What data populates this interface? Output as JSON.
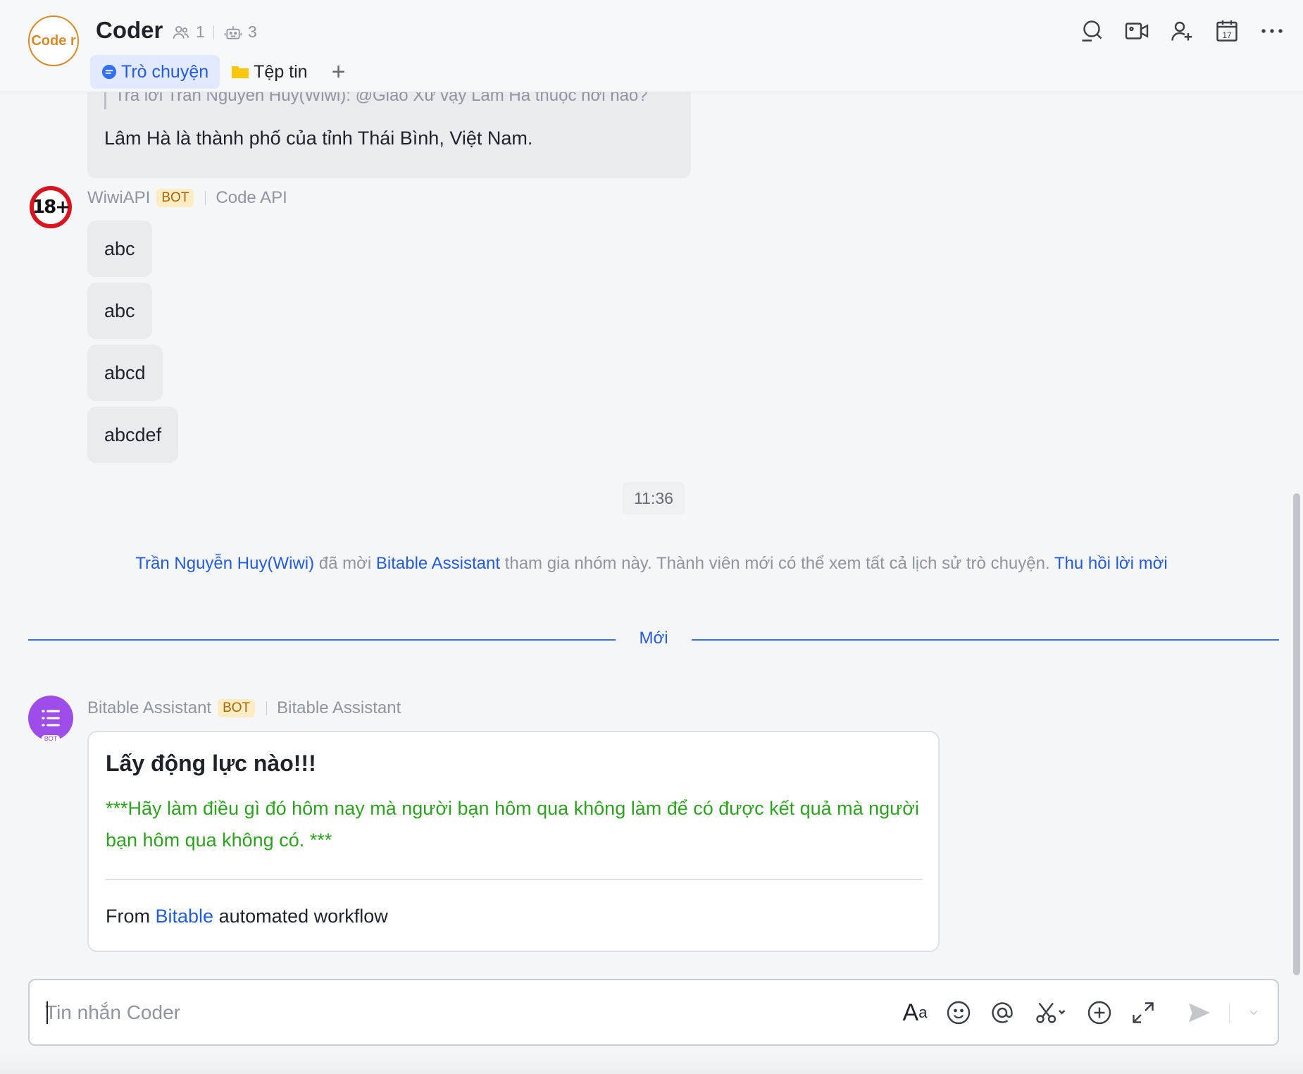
{
  "header": {
    "avatar_text": "Code r",
    "title": "Coder",
    "members_count": "1",
    "bots_count": "3",
    "tabs": [
      {
        "label": "Trò chuyện",
        "icon": "chat-bubble-icon"
      },
      {
        "label": "Tệp tin",
        "icon": "folder-icon"
      }
    ],
    "add_tab": "+",
    "icons": [
      "search-icon",
      "video-call-icon",
      "add-member-icon",
      "calendar-icon",
      "more-icon"
    ],
    "calendar_day": "17"
  },
  "messages": {
    "quoted_reply": {
      "quote": "Trả lời Trần Nguyễn Huy(Wiwi): @Giáo Xứ vậy Lâm Hà thuộc nơi nào?",
      "text": "Lâm Hà là thành phố của tỉnh Thái Bình, Việt Nam."
    },
    "wiwi": {
      "avatar_text": "18+",
      "sender": "WiwiAPI",
      "badge": "BOT",
      "source": "Code API",
      "bubbles": [
        "abc",
        "abc",
        "abcd",
        "abcdef"
      ]
    },
    "time": "11:36",
    "system": {
      "inviter": "Trần Nguyễn Huy(Wiwi)",
      "verb": "đã mời",
      "invitee": "Bitable Assistant",
      "rest": "tham gia nhóm này. Thành viên mới có thể xem tất cả lịch sử trò chuyện.",
      "revoke": "Thu hồi lời mời"
    },
    "new_divider": "Mới",
    "bitable": {
      "sender": "Bitable Assistant",
      "badge": "BOT",
      "source": "Bitable Assistant",
      "avatar_badge": "BOT",
      "card": {
        "title": "Lấy động lực nào!!!",
        "body": " ***Hãy làm điều gì đó hôm nay mà người bạn hôm qua không làm để có được kết quả mà người bạn hôm qua không có. ***",
        "footer_prefix": "From",
        "footer_link": "Bitable",
        "footer_suffix": "automated workflow"
      }
    }
  },
  "composer": {
    "placeholder": "Tin nhắn Coder",
    "value": "",
    "icons": [
      "text-format-icon",
      "emoji-icon",
      "mention-icon",
      "scissors-icon",
      "add-circle-icon",
      "expand-icon",
      "send-icon",
      "send-options-chevron-icon"
    ]
  },
  "colors": {
    "accent": "#245bdb",
    "bot_badge_bg": "#fdecc4",
    "bot_badge_text": "#a86400",
    "card_body_green": "#2ea121",
    "divider_blue": "#3370ff"
  }
}
